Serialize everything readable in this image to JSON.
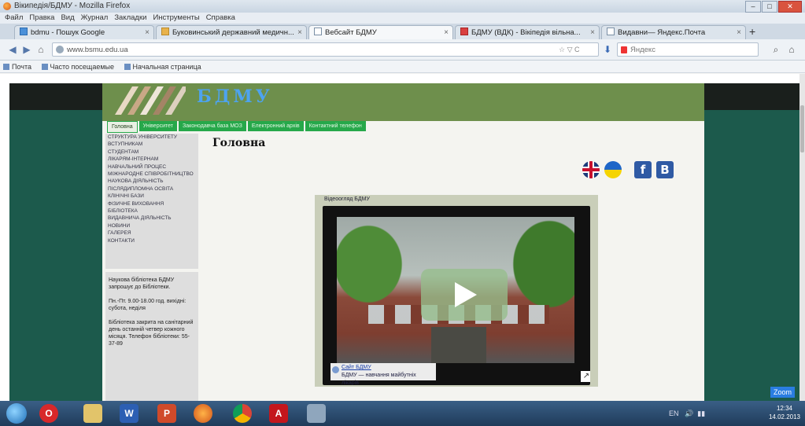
{
  "browser": {
    "window_title": "Вікипедія/БДМУ - Mozilla Firefox",
    "menu": [
      "Файл",
      "Правка",
      "Вид",
      "Журнал",
      "Закладки",
      "Инструменты",
      "Справка"
    ],
    "tabs": [
      {
        "label": "bdmu - Пошук Google",
        "icon": "google"
      },
      {
        "label": "Буковинський державний медичн...",
        "icon": "img"
      },
      {
        "label": "Вебсайт БДМУ",
        "icon": "page"
      },
      {
        "label": "БДМУ (ВДК) - Вікіпедія вільна...",
        "icon": "yt"
      },
      {
        "label": "Видавни— Яндекс.Почта",
        "icon": "page"
      }
    ],
    "new_tab_symbol": "+",
    "url": "www.bsmu.edu.ua",
    "url_right_text": "☆ ▽ C",
    "search_placeholder": "Яндекс",
    "bookmarks": [
      "Почта",
      "Часто посещаемые",
      "Начальная страница"
    ]
  },
  "site": {
    "name": "БДМУ",
    "top_nav": [
      "Головна",
      "Університет",
      "Законодавча база МОЗ",
      "Електронний архів",
      "Контактний телефон"
    ],
    "left_menu": [
      "Структура університету",
      "Вступникам",
      "Студентам",
      "Лікарям-інтернам",
      "Навчальний процес",
      "Міжнародне співробітництво",
      "Наукова діяльність",
      "Післядипломна освіта",
      "Клінічні бази",
      "Фізичне виховання",
      "Бібліотека",
      "Видавнича діяльність",
      "Новини",
      "Галерея",
      "Контакти"
    ],
    "info": [
      "Наукова бібліотека БДМУ запрошує до Бібліотеки.",
      "Пн.-Пт. 9.00-18.00 год. вихідні: субота, неділя",
      "Бібліотека закрита на санітарний день останній четвер кожного місяця. Телефон бібліотеки: 55-37-89"
    ],
    "page_title": "Головна",
    "social": [
      {
        "name": "english-flag-icon",
        "glyph": ""
      },
      {
        "name": "ukrainian-flag-icon",
        "glyph": ""
      },
      {
        "name": "facebook-icon",
        "glyph": "f"
      },
      {
        "name": "vkontakte-icon",
        "glyph": "B"
      }
    ],
    "video": {
      "heading": "Відеоогляд БДМУ",
      "channel": "Сайт БДМУ",
      "description": "БДМУ — навчання майбутніх лікарів",
      "share_symbol": "↗"
    }
  },
  "os": {
    "taskbar_clock_time": "12:34",
    "taskbar_clock_date": "14.02.2013",
    "tray_text": "EN",
    "zoom_label": "Zoom"
  }
}
